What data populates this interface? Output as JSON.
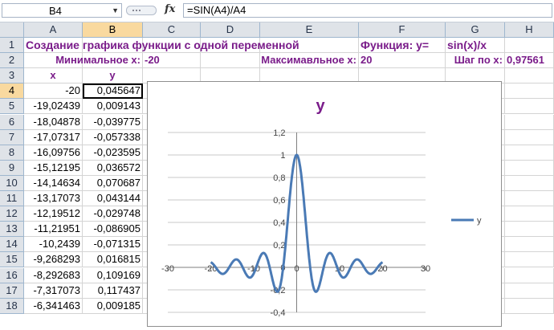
{
  "formula_bar": {
    "name_box": "B4",
    "fx": "fx",
    "formula": "=SIN(A4)/A4"
  },
  "columns": [
    "A",
    "B",
    "C",
    "D",
    "E",
    "F",
    "G",
    "H"
  ],
  "rows": [
    "1",
    "2",
    "3",
    "4",
    "5",
    "6",
    "7",
    "8",
    "9",
    "10",
    "11",
    "12",
    "13",
    "14",
    "15",
    "16",
    "17",
    "18"
  ],
  "sheet": {
    "title": "Создание графика функции с одной переменной",
    "function_label": "Функция: y=",
    "function_value": "sin(x)/x",
    "min_label": "Минимальное x:",
    "min_value": "-20",
    "max_label": "Максимавльное x:",
    "max_value": "20",
    "step_label": "Шаг по x:",
    "step_value": "0,97561",
    "col_x": "x",
    "col_y": "y"
  },
  "table": [
    [
      "-20",
      "0,045647"
    ],
    [
      "-19,02439",
      "0,009143"
    ],
    [
      "-18,04878",
      "-0,039775"
    ],
    [
      "-17,07317",
      "-0,057338"
    ],
    [
      "-16,09756",
      "-0,023595"
    ],
    [
      "-15,12195",
      "0,036572"
    ],
    [
      "-14,14634",
      "0,070687"
    ],
    [
      "-13,17073",
      "0,043144"
    ],
    [
      "-12,19512",
      "-0,029748"
    ],
    [
      "-11,21951",
      "-0,086905"
    ],
    [
      "-10,2439",
      "-0,071315"
    ],
    [
      "-9,268293",
      "0,016815"
    ],
    [
      "-8,292683",
      "0,109169"
    ],
    [
      "-7,317073",
      "0,117437"
    ],
    [
      "-6,341463",
      "0,009185"
    ]
  ],
  "chart_data": {
    "type": "line",
    "title": "y",
    "xlim": [
      -30,
      30
    ],
    "ylim": [
      -0.4,
      1.2
    ],
    "x_ticks": [
      "-30",
      "-20",
      "-10",
      "0",
      "10",
      "20",
      "30"
    ],
    "y_ticks": [
      "-0,4",
      "-0,2",
      "0",
      "0,2",
      "0,4",
      "0,6",
      "0,8",
      "1",
      "1,2"
    ],
    "legend": "right",
    "series": [
      {
        "name": "y",
        "color": "#4a7ab5",
        "function": "sin(x)/x",
        "x_from": -20,
        "x_to": 20
      }
    ]
  }
}
